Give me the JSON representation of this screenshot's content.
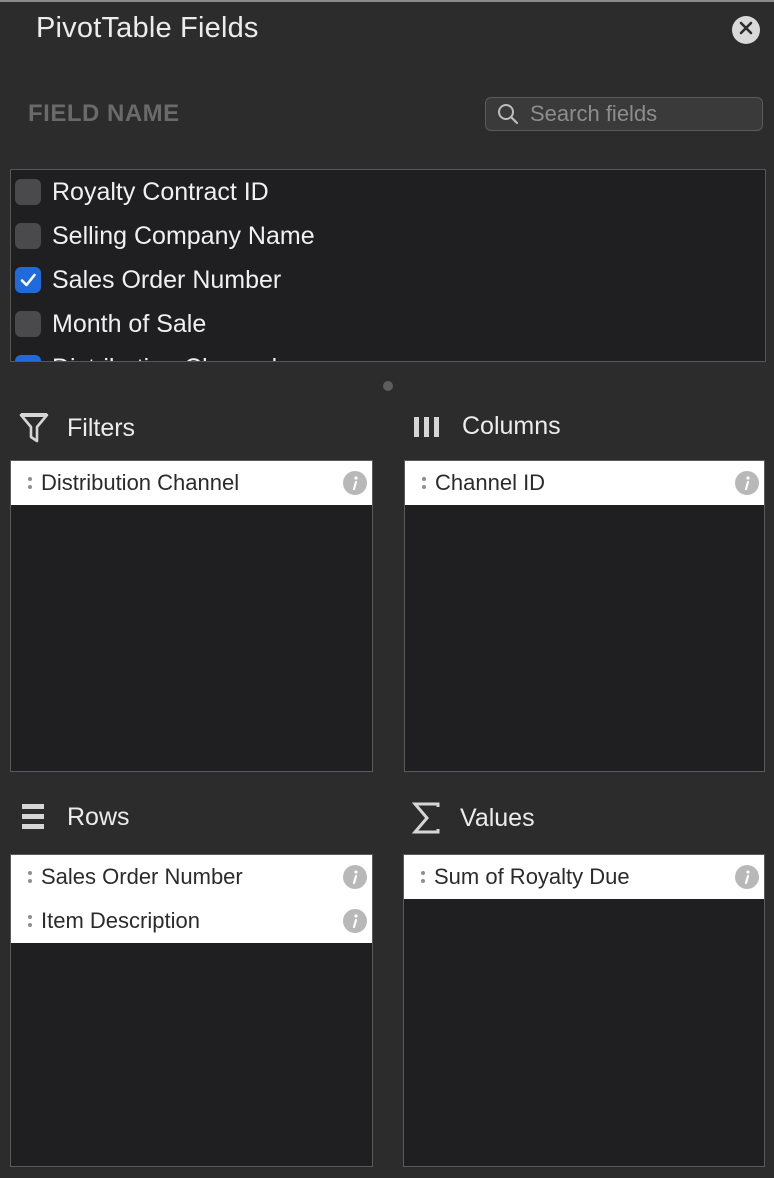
{
  "panel": {
    "title": "PivotTable Fields",
    "close_icon": "close-icon"
  },
  "fields_header": {
    "label": "FIELD NAME",
    "search_placeholder": "Search fields",
    "search_value": ""
  },
  "fields": [
    {
      "label": "Royalty Contract ID",
      "checked": false
    },
    {
      "label": "Selling Company Name",
      "checked": false
    },
    {
      "label": "Sales Order Number",
      "checked": true
    },
    {
      "label": "Month of Sale",
      "checked": false
    },
    {
      "label": "Distribution Channel",
      "checked": true
    }
  ],
  "areas": {
    "filters": {
      "label": "Filters",
      "icon": "funnel-icon",
      "items": [
        {
          "label": "Distribution Channel"
        }
      ]
    },
    "columns": {
      "label": "Columns",
      "icon": "columns-icon",
      "items": [
        {
          "label": "Channel ID"
        }
      ]
    },
    "rows": {
      "label": "Rows",
      "icon": "rows-icon",
      "items": [
        {
          "label": "Sales Order Number"
        },
        {
          "label": "Item Description"
        }
      ]
    },
    "values": {
      "label": "Values",
      "icon": "sigma-icon",
      "items": [
        {
          "label": "Sum of Royalty Due"
        }
      ]
    }
  },
  "colors": {
    "background": "#2c2c2d",
    "well": "#1f1f21",
    "checkbox_checked": "#1f6bdc",
    "pill": "#ffffff"
  }
}
